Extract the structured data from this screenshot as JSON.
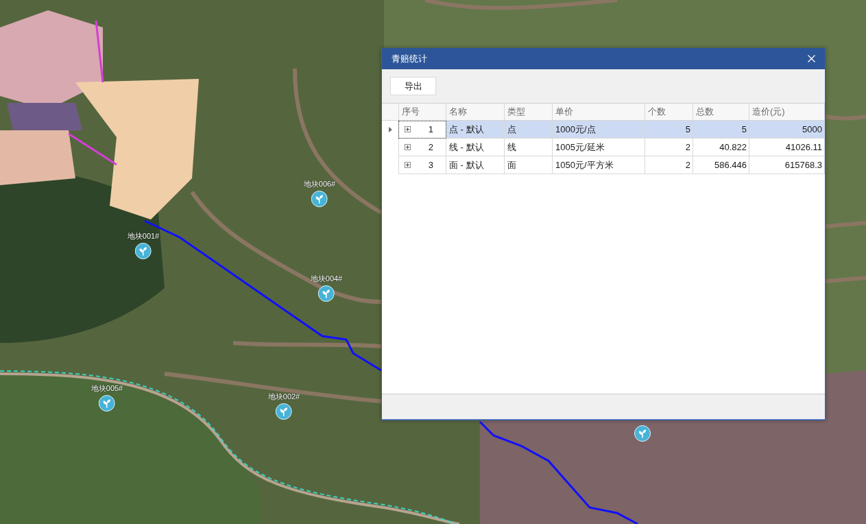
{
  "map": {
    "markers": [
      {
        "kind": "labeled",
        "label": "地块006#"
      },
      {
        "kind": "labeled",
        "label": "地块001#"
      },
      {
        "kind": "labeled",
        "label": "地块004#"
      },
      {
        "kind": "labeled",
        "label": "地块005#"
      },
      {
        "kind": "labeled",
        "label": "地块002#"
      },
      {
        "kind": "icon_only"
      }
    ]
  },
  "dialog": {
    "title": "青赔统计",
    "toolbar": {
      "buttons": [
        "导出"
      ]
    },
    "table": {
      "columns": [
        "序号",
        "名称",
        "类型",
        "单价",
        "个数",
        "总数",
        "造价(元)"
      ],
      "rows": [
        {
          "selected": true,
          "expanded": false,
          "cells": [
            "1",
            "点 - 默认",
            "点",
            "1000元/点",
            "5",
            "5",
            "5000"
          ]
        },
        {
          "selected": false,
          "expanded": false,
          "cells": [
            "2",
            "线 - 默认",
            "线",
            "1005元/延米",
            "2",
            "40.822",
            "41026.11"
          ]
        },
        {
          "selected": false,
          "expanded": false,
          "cells": [
            "3",
            "面 - 默认",
            "面",
            "1050元/平方米",
            "2",
            "586.446",
            "615768.3"
          ]
        }
      ]
    }
  }
}
